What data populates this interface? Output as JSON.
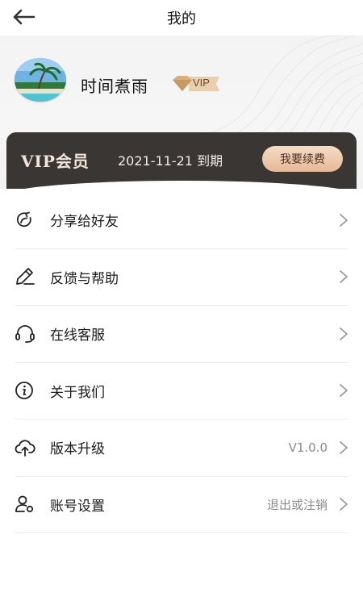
{
  "header": {
    "title": "我的"
  },
  "profile": {
    "username": "时间煮雨",
    "vip_badge": "VIP"
  },
  "vip_card": {
    "label": "VIP会员",
    "expiry": "2021-11-21 到期",
    "renew_label": "我要续费"
  },
  "menu": {
    "items": [
      {
        "label": "分享给好友",
        "icon": "share-icon",
        "value": ""
      },
      {
        "label": "反馈与帮助",
        "icon": "pencil-icon",
        "value": ""
      },
      {
        "label": "在线客服",
        "icon": "headset-icon",
        "value": ""
      },
      {
        "label": "关于我们",
        "icon": "info-icon",
        "value": ""
      },
      {
        "label": "版本升级",
        "icon": "cloud-upload-icon",
        "value": "V1.0.0"
      },
      {
        "label": "账号设置",
        "icon": "user-settings-icon",
        "value": "退出或注销"
      }
    ]
  },
  "colors": {
    "vip_card_bg": "#3a3634",
    "renew_button": "#e6b897",
    "accent_gold": "#d9b98f"
  }
}
